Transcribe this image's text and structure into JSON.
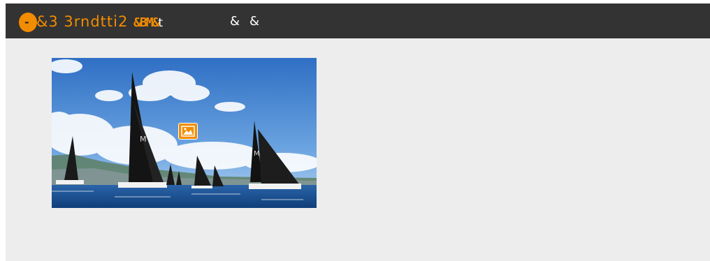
{
  "header": {
    "brand_mark": "-",
    "brand_title_a": "&3 3rndtti2 ",
    "brand_title_b": "&BM&",
    "brand_title_tail": "t",
    "nav": [
      {
        "label": "&"
      },
      {
        "label": "&"
      }
    ]
  },
  "colors": {
    "topbar": "#333333",
    "accent": "#f28c00",
    "canvas": "#ededed"
  },
  "hero": {
    "icon": "image-icon",
    "subject": "sailboats-racing-photo"
  }
}
